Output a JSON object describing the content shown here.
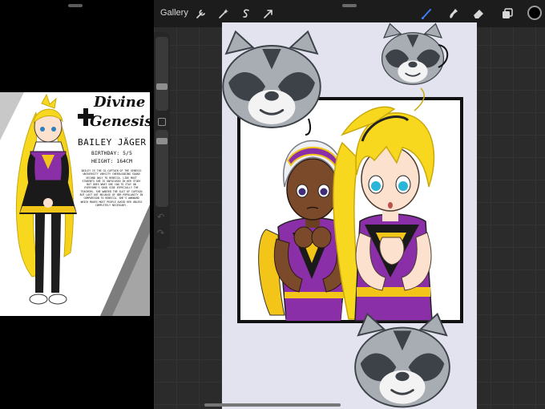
{
  "toolbar": {
    "gallery_label": "Gallery",
    "actions": [
      {
        "icon": "wrench-icon"
      },
      {
        "icon": "magic-wand-icon"
      },
      {
        "icon": "selection-s-icon"
      },
      {
        "icon": "transform-arrow-icon"
      }
    ],
    "tools": [
      {
        "icon": "brush-icon",
        "active": true
      },
      {
        "icon": "smudge-icon"
      },
      {
        "icon": "eraser-icon"
      },
      {
        "icon": "layers-icon"
      }
    ],
    "color_swatch": "#000000",
    "accent": "#3f7bf5"
  },
  "reference_card": {
    "title_line1": "Divine",
    "title_line2": "Genesis",
    "name": "BAILEY JÄGER",
    "birthday": "BIRTHDAY: 5/5",
    "height": "HEIGHT: 164CM",
    "bio": "BAILEY IS THE CO-CAPTAIN OF THE GENESIS UNIVERSITY VARSITY CHEERLEADING SQUAD SECOND ONLY TO REBECCA. LIKE MOST STUDENTS SHE IS UNFOCUSED IN HER STUDY BUT DOES WHAT SHE CAN TO STAY ON EVERYONE'S GOOD SIDE ESPECIALLY THE TEACHERS. SHE WANTED THE SLOT OF CAPTAIN BUT LOST OUT BECAUSE OF HER POPULARITY IN COMPARISON TO REBECCA. SHE'S AWKWARD WHICH MAKES MOST PEOPLE AVOID HER UNLESS COMPLETELY NECESSARY."
  },
  "colors": {
    "uniform_purple": "#8b2fa8",
    "uniform_yellow": "#f2c518",
    "hair_blonde": "#f7d81f",
    "raccoon_gray": "#a8adb3",
    "raccoon_dark": "#3d4148",
    "canvas_bg": "#e2e3ef"
  }
}
